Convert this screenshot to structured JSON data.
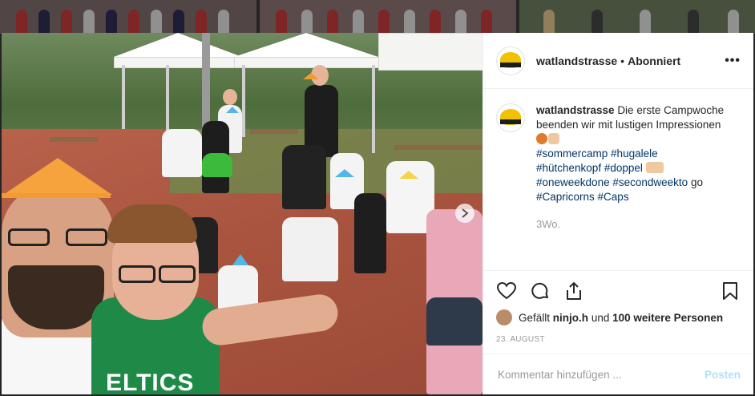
{
  "post": {
    "username": "watlandstrasse",
    "separator": "•",
    "follow_status": "Abonniert",
    "more_label": "•••",
    "caption": {
      "username": "watlandstrasse",
      "text": "Die erste Campwoche beenden wir mit lustigen Impressionen",
      "hashtags_line1": [
        "#sommercamp",
        "#hugalele"
      ],
      "hashtags_line2": [
        "#hütchenkopf",
        "#doppel"
      ],
      "hashtags_line3": [
        "#oneweekdone",
        "#secondweekto"
      ],
      "line3_tail": "go",
      "hashtags_line4": [
        "#Capricorns",
        "#Caps"
      ]
    },
    "time_ago": "3Wo.",
    "likes": {
      "prefix": "Gefällt",
      "user": "ninjo.h",
      "connector": "und",
      "others": "100 weitere Personen"
    },
    "date": "23. AUGUST",
    "comment_placeholder": "Kommentar hinzufügen ...",
    "post_label": "Posten",
    "photo_text": "ELTICS"
  },
  "colors": {
    "hashtag": "#003569",
    "post_button": "#b2dffc",
    "muted": "#999999"
  },
  "icons": [
    "more-icon",
    "heart-icon",
    "comment-icon",
    "share-icon",
    "bookmark-icon",
    "next-arrow-icon"
  ]
}
